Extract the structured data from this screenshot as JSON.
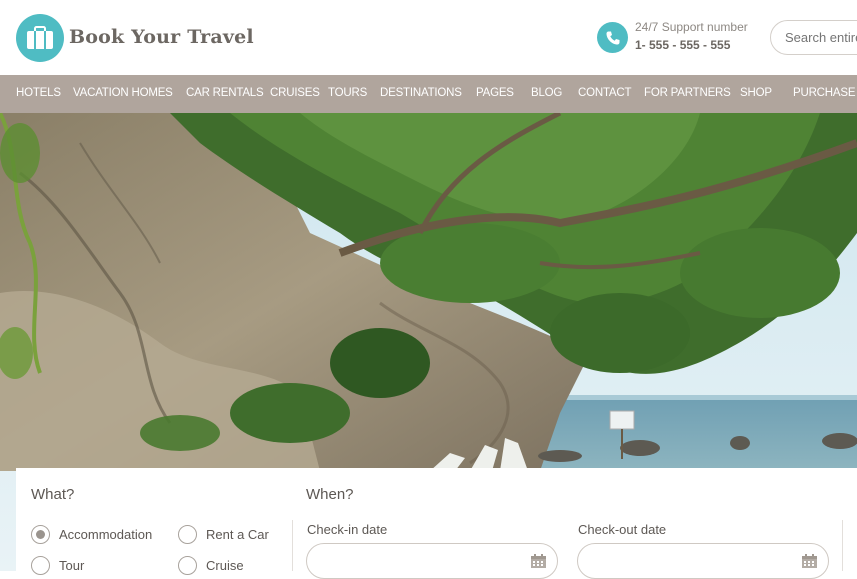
{
  "brand": {
    "name": "Book Your Travel"
  },
  "support": {
    "label": "24/7 Support number",
    "number": "1- 555 - 555 - 555"
  },
  "search": {
    "placeholder": "Search entire"
  },
  "nav": [
    "HOTELS",
    "VACATION HOMES",
    "CAR RENTALS",
    "CRUISES",
    "TOURS",
    "DESTINATIONS",
    "PAGES",
    "BLOG",
    "CONTACT",
    "FOR PARTNERS",
    "SHOP",
    "PURCHASE THEME"
  ],
  "form": {
    "what_label": "What?",
    "when_label": "When?",
    "options": [
      {
        "label": "Accommodation",
        "selected": true
      },
      {
        "label": "Rent a Car",
        "selected": false
      },
      {
        "label": "Tour",
        "selected": false
      },
      {
        "label": "Cruise",
        "selected": false
      }
    ],
    "checkin_label": "Check-in date",
    "checkout_label": "Check-out date"
  },
  "colors": {
    "accent": "#4fbcc3",
    "nav_bg": "#b0a59d",
    "text": "#5d5854"
  },
  "icons": [
    "suitcase-icon",
    "phone-icon",
    "calendar-icon"
  ]
}
